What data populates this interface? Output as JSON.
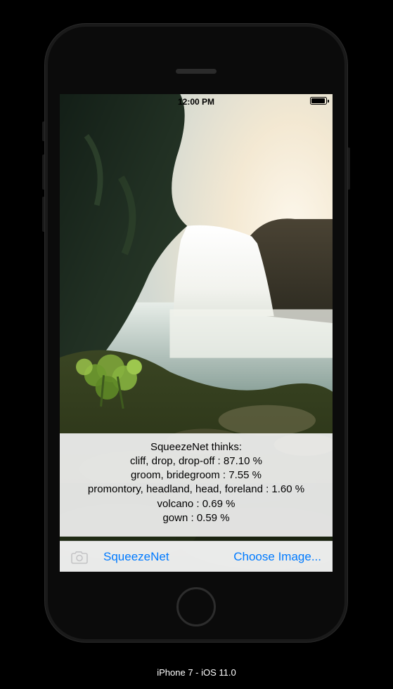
{
  "statusbar": {
    "time": "12:00 PM"
  },
  "results": {
    "title": "SqueezeNet thinks:",
    "lines": [
      "cliff, drop, drop-off : 87.10 %",
      "groom, bridegroom : 7.55 %",
      "promontory, headland, head, foreland : 1.60 %",
      "volcano : 0.69 %",
      "gown : 0.59 %"
    ]
  },
  "toolbar": {
    "model_label": "SqueezeNet",
    "choose_label": "Choose Image..."
  },
  "caption": "iPhone 7 - iOS 11.0",
  "colors": {
    "ios_blue": "#007aff"
  }
}
